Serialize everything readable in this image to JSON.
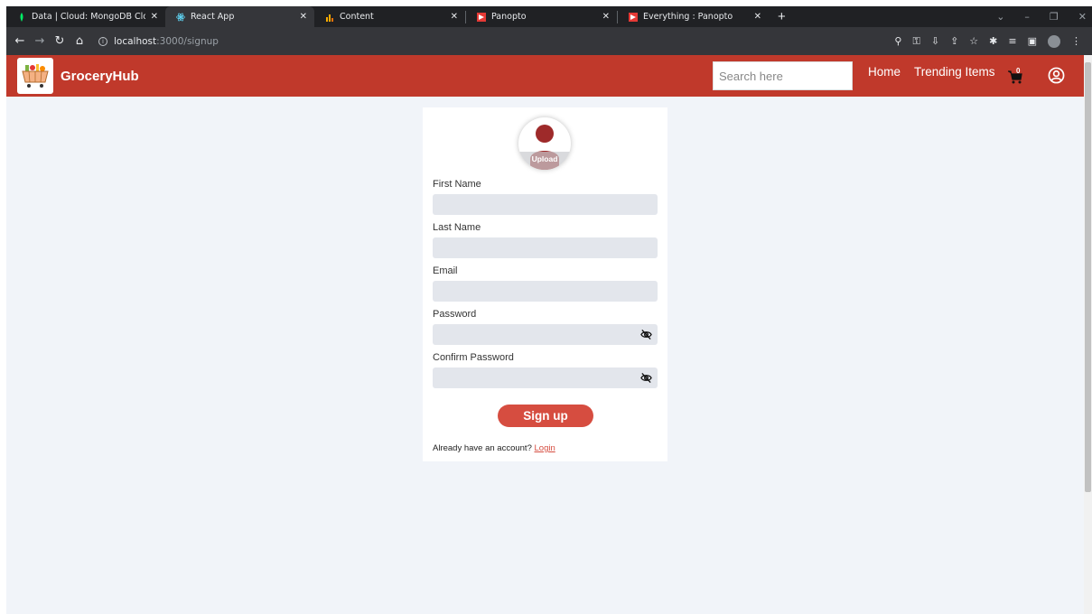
{
  "browser": {
    "tabs": [
      {
        "title": "Data | Cloud: MongoDB Cloud",
        "icon": "mongodb-leaf-icon",
        "color": "#00ed64"
      },
      {
        "title": "React App",
        "icon": "react-icon",
        "color": "#61dafb"
      },
      {
        "title": "Content",
        "icon": "bar-chart-icon",
        "color": "#f9ab00"
      },
      {
        "title": "Panopto",
        "icon": "panopto-icon",
        "color": "#e53935"
      },
      {
        "title": "Everything : Panopto",
        "icon": "panopto-icon",
        "color": "#e53935"
      }
    ],
    "active_tab": 1,
    "address": {
      "host": "localhost",
      "path": ":3000/signup"
    }
  },
  "app": {
    "brand": "GroceryHub",
    "search_placeholder": "Search here",
    "nav": {
      "home": "Home",
      "trending": "Trending Items"
    },
    "cart_count": "0",
    "colors": {
      "primary": "#c0392b",
      "button": "#d64d40",
      "background": "#f1f4f9",
      "field": "#e3e6ec"
    }
  },
  "signup": {
    "upload_label": "Upload",
    "fields": {
      "first_name": {
        "label": "First Name",
        "value": ""
      },
      "last_name": {
        "label": "Last Name",
        "value": ""
      },
      "email": {
        "label": "Email",
        "value": ""
      },
      "password": {
        "label": "Password",
        "value": ""
      },
      "confirm_password": {
        "label": "Confirm Password",
        "value": ""
      }
    },
    "submit_label": "Sign up",
    "login_prompt": "Already have an account?",
    "login_link": "Login"
  }
}
